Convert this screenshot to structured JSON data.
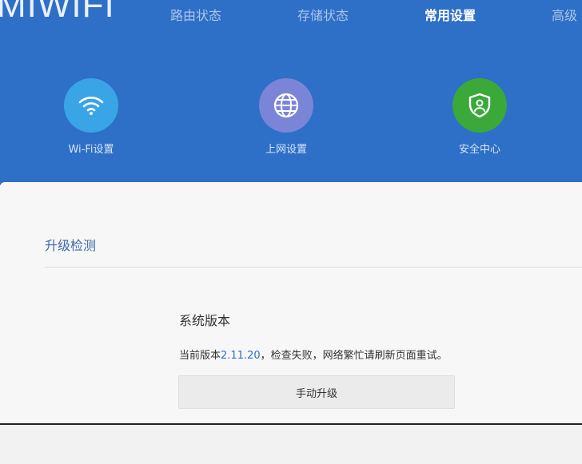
{
  "header": {
    "logo": "MIWIFI",
    "nav": [
      {
        "label": "路由状态",
        "active": false
      },
      {
        "label": "存储状态",
        "active": false
      },
      {
        "label": "常用设置",
        "active": true
      },
      {
        "label": "高级",
        "active": false
      }
    ],
    "features": [
      {
        "label": "Wi-Fi设置",
        "icon": "wifi-icon",
        "color": "#39a5e6"
      },
      {
        "label": "上网设置",
        "icon": "globe-icon",
        "color": "#7b85d8"
      },
      {
        "label": "安全中心",
        "icon": "shield-icon",
        "color": "#3aa93a"
      }
    ],
    "background_color": "#2e6fc7"
  },
  "panel": {
    "title": "升级检测",
    "section_title": "系统版本",
    "version_prefix": "当前版本",
    "version": "2.11.20",
    "version_suffix": "，检查失败，网络繁忙请刷新页面重试。",
    "button_label": "手动升级"
  }
}
